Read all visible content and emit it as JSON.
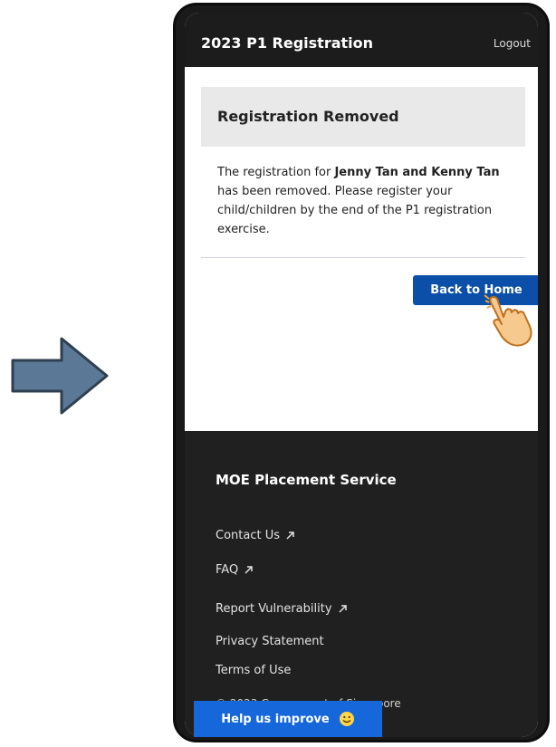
{
  "header": {
    "title": "2023 P1 Registration",
    "logout_label": "Logout"
  },
  "card": {
    "title": "Registration Removed",
    "message_prefix": "The registration for ",
    "message_names": "Jenny Tan and Kenny Tan",
    "message_suffix": " has been removed. Please register your child/children by the end of the P1 registration exercise."
  },
  "back_button_label": "Back to Home",
  "footer": {
    "title": "MOE Placement Service",
    "links": [
      {
        "label": "Contact Us",
        "icon": "external-link-icon"
      },
      {
        "label": "FAQ",
        "icon": "external-link-icon"
      },
      {
        "label": "Report Vulnerability",
        "icon": "external-link-icon"
      },
      {
        "label": "Privacy Statement"
      },
      {
        "label": "Terms of Use"
      }
    ],
    "copyright": "© 2023 Government of Singapore"
  },
  "help_button": {
    "label": "Help us improve",
    "icon": "smile-icon"
  },
  "colors": {
    "topbar": "#1c1c1c",
    "button_blue": "#0b4fa8",
    "help_blue": "#1667d9",
    "footer": "#202020",
    "arrow": "#5b7896"
  }
}
